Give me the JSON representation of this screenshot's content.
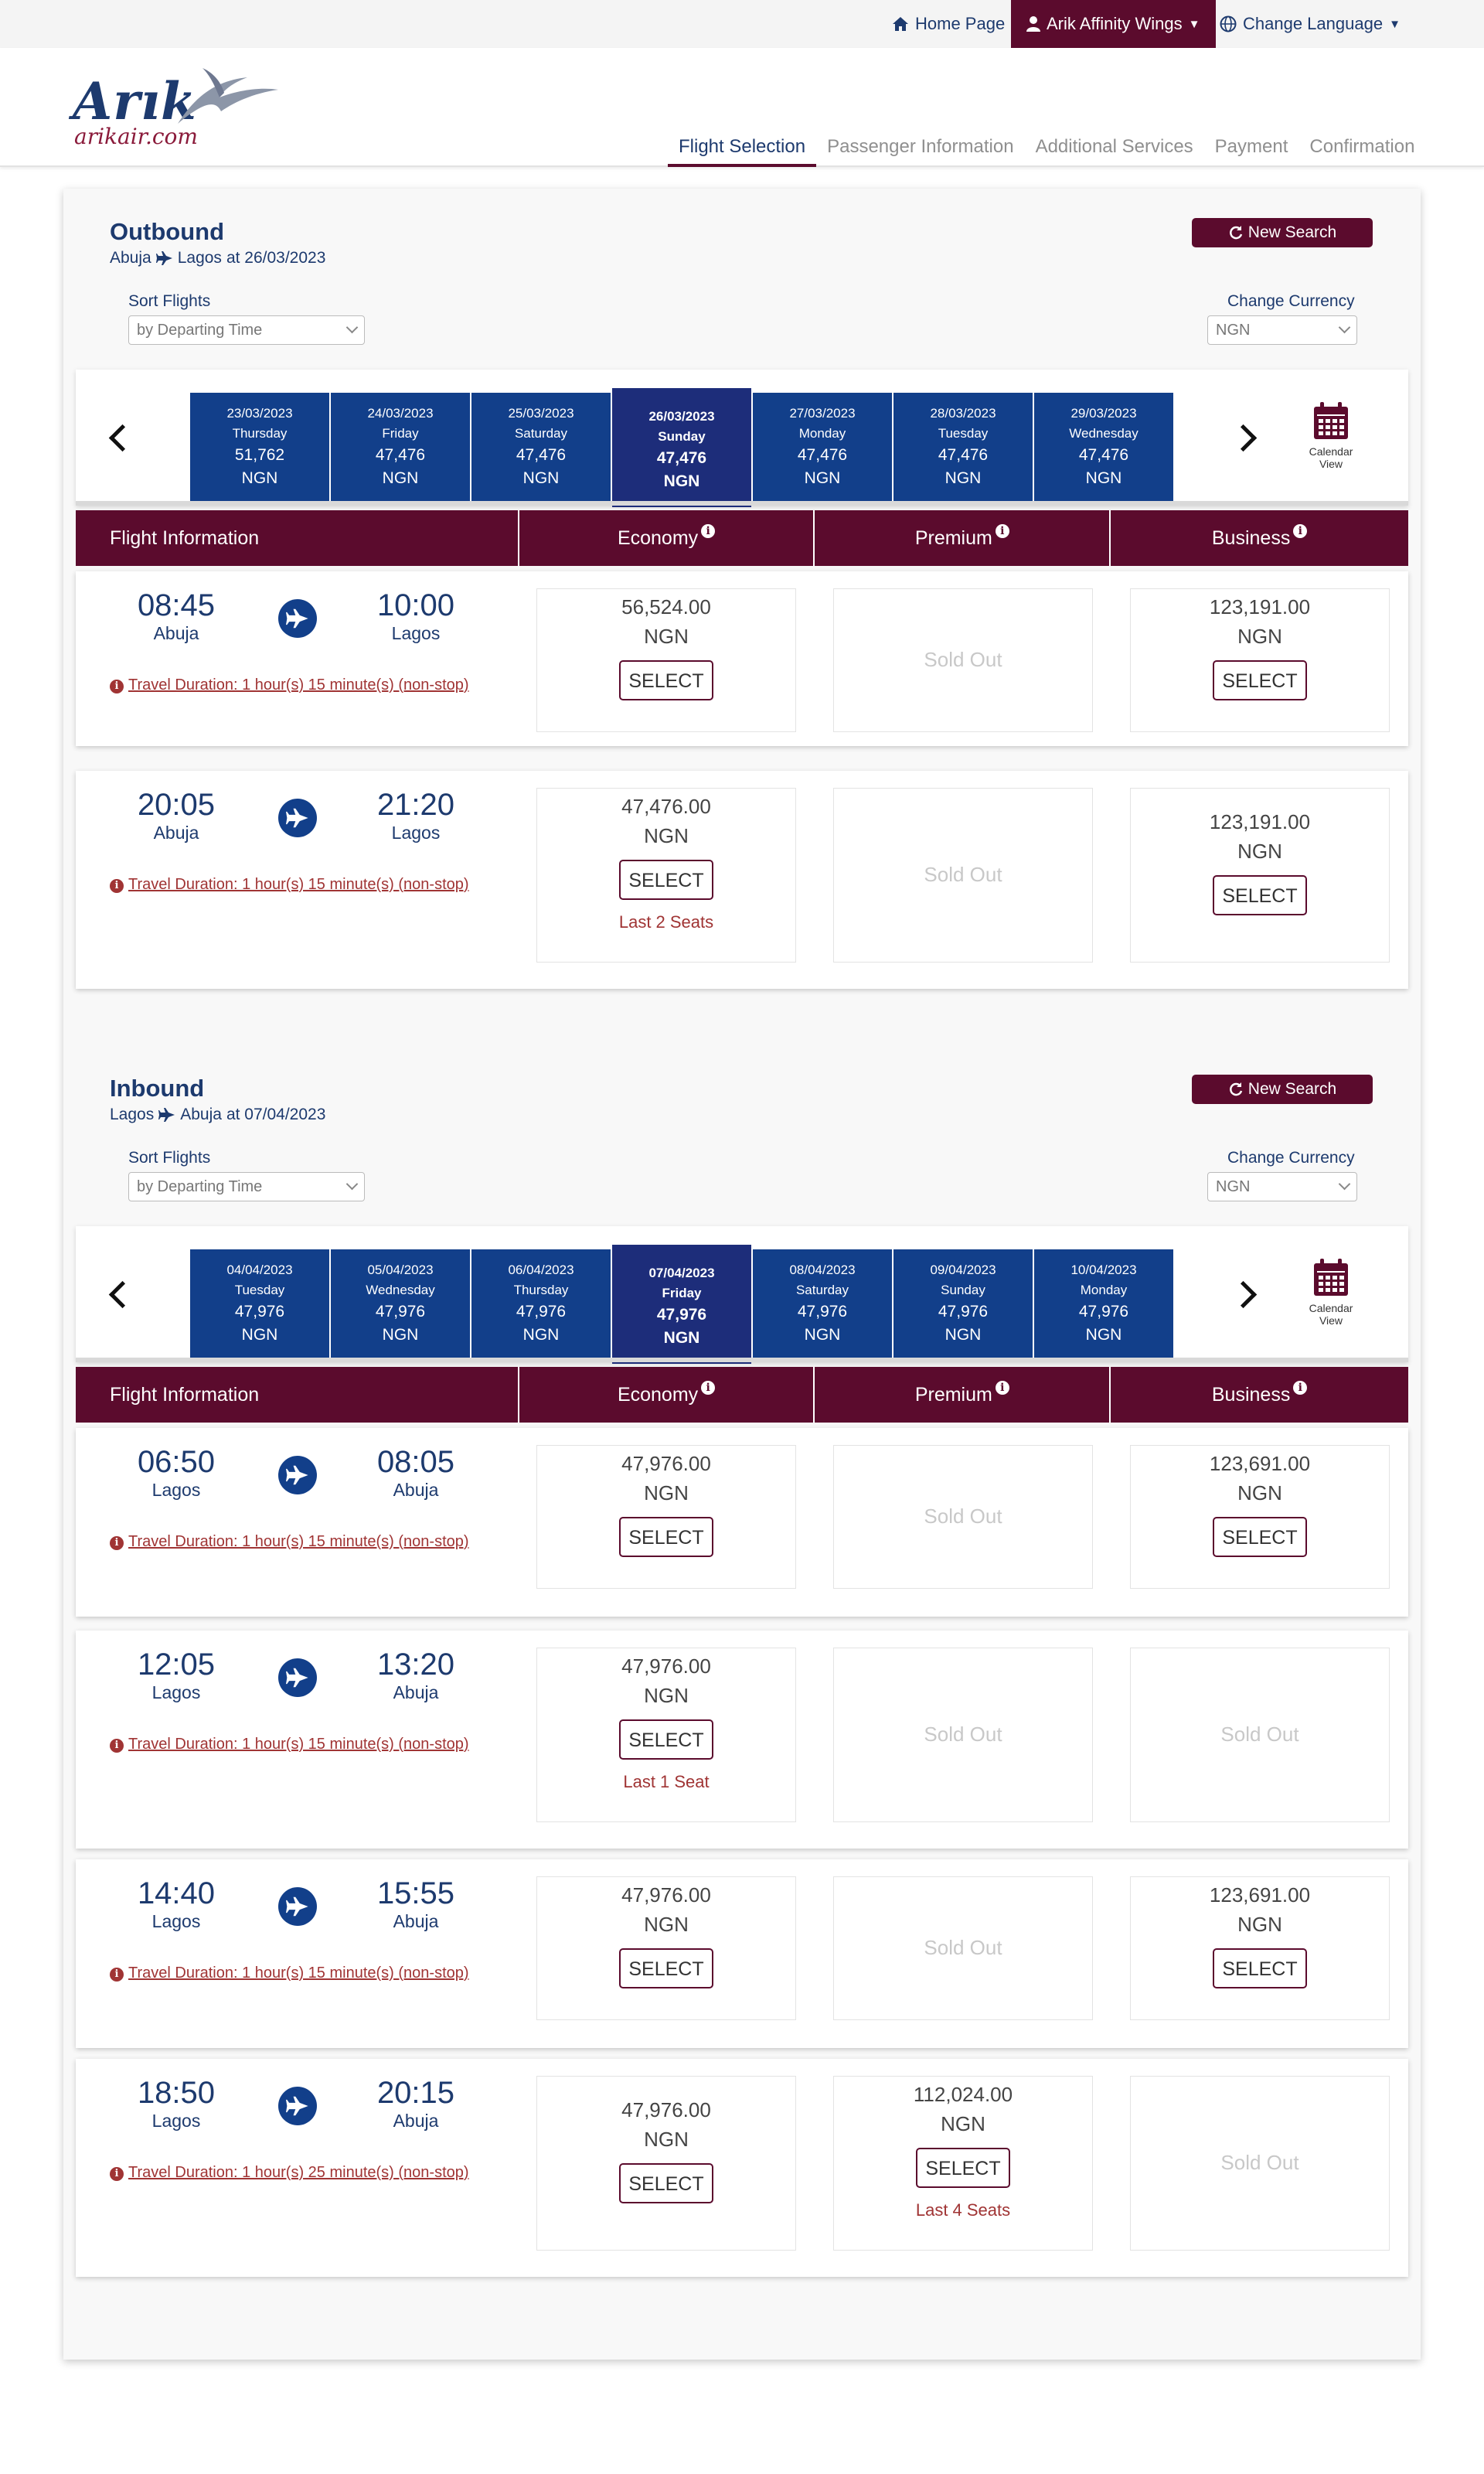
{
  "topbar": {
    "home": "Home Page",
    "affinity": "Arik Affinity Wings",
    "language": "Change Language"
  },
  "brand": {
    "name": "Arık",
    "url": "arikair.com"
  },
  "steps": [
    "Flight Selection",
    "Passenger Information",
    "Additional Services",
    "Payment",
    "Confirmation"
  ],
  "colors": {
    "primary": "#5b0b2d",
    "navy": "#1d3a6e",
    "date_tile": "#123f8a",
    "date_tile_active": "#1d2d7a",
    "alert": "#a03434"
  },
  "sections": [
    {
      "title": "Outbound",
      "from": "Abuja",
      "to": "Lagos",
      "date_text": "at 26/03/2023",
      "new_search": "New Search",
      "sort_label": "Sort Flights",
      "sort_value": "by Departing Time",
      "currency_label": "Change Currency",
      "currency_value": "NGN",
      "calendar_label": "Calendar View",
      "headers": {
        "info": "Flight Information",
        "economy": "Economy",
        "premium": "Premium",
        "business": "Business",
        "info_icon": "i"
      },
      "days": [
        {
          "date": "23/03/2023",
          "weekday": "Thursday",
          "price": "51,762",
          "cur": "NGN",
          "active": false
        },
        {
          "date": "24/03/2023",
          "weekday": "Friday",
          "price": "47,476",
          "cur": "NGN",
          "active": false
        },
        {
          "date": "25/03/2023",
          "weekday": "Saturday",
          "price": "47,476",
          "cur": "NGN",
          "active": false
        },
        {
          "date": "26/03/2023",
          "weekday": "Sunday",
          "price": "47,476",
          "cur": "NGN",
          "active": true
        },
        {
          "date": "27/03/2023",
          "weekday": "Monday",
          "price": "47,476",
          "cur": "NGN",
          "active": false
        },
        {
          "date": "28/03/2023",
          "weekday": "Tuesday",
          "price": "47,476",
          "cur": "NGN",
          "active": false
        },
        {
          "date": "29/03/2023",
          "weekday": "Wednesday",
          "price": "47,476",
          "cur": "NGN",
          "active": false
        }
      ],
      "flights": [
        {
          "dep_time": "08:45",
          "dep_city": "Abuja",
          "arr_time": "10:00",
          "arr_city": "Lagos",
          "duration": "Travel Duration: 1 hour(s) 15 minute(s) (non-stop)",
          "economy": {
            "price": "56,524.00",
            "cur": "NGN",
            "select": "SELECT",
            "seats": ""
          },
          "premium": {
            "sold_out": "Sold Out"
          },
          "business": {
            "price": "123,191.00",
            "cur": "NGN",
            "select": "SELECT",
            "seats": ""
          }
        },
        {
          "dep_time": "20:05",
          "dep_city": "Abuja",
          "arr_time": "21:20",
          "arr_city": "Lagos",
          "duration": "Travel Duration: 1 hour(s) 15 minute(s) (non-stop)",
          "economy": {
            "price": "47,476.00",
            "cur": "NGN",
            "select": "SELECT",
            "seats": "Last 2 Seats"
          },
          "premium": {
            "sold_out": "Sold Out"
          },
          "business": {
            "price": "123,191.00",
            "cur": "NGN",
            "select": "SELECT",
            "seats": ""
          }
        }
      ]
    },
    {
      "title": "Inbound",
      "from": "Lagos",
      "to": "Abuja",
      "date_text": "at 07/04/2023",
      "new_search": "New Search",
      "sort_label": "Sort Flights",
      "sort_value": "by Departing Time",
      "currency_label": "Change Currency",
      "currency_value": "NGN",
      "calendar_label": "Calendar View",
      "headers": {
        "info": "Flight Information",
        "economy": "Economy",
        "premium": "Premium",
        "business": "Business",
        "info_icon": "i"
      },
      "days": [
        {
          "date": "04/04/2023",
          "weekday": "Tuesday",
          "price": "47,976",
          "cur": "NGN",
          "active": false
        },
        {
          "date": "05/04/2023",
          "weekday": "Wednesday",
          "price": "47,976",
          "cur": "NGN",
          "active": false
        },
        {
          "date": "06/04/2023",
          "weekday": "Thursday",
          "price": "47,976",
          "cur": "NGN",
          "active": false
        },
        {
          "date": "07/04/2023",
          "weekday": "Friday",
          "price": "47,976",
          "cur": "NGN",
          "active": true
        },
        {
          "date": "08/04/2023",
          "weekday": "Saturday",
          "price": "47,976",
          "cur": "NGN",
          "active": false
        },
        {
          "date": "09/04/2023",
          "weekday": "Sunday",
          "price": "47,976",
          "cur": "NGN",
          "active": false
        },
        {
          "date": "10/04/2023",
          "weekday": "Monday",
          "price": "47,976",
          "cur": "NGN",
          "active": false
        }
      ],
      "flights": [
        {
          "dep_time": "06:50",
          "dep_city": "Lagos",
          "arr_time": "08:05",
          "arr_city": "Abuja",
          "duration": "Travel Duration: 1 hour(s) 15 minute(s) (non-stop)",
          "economy": {
            "price": "47,976.00",
            "cur": "NGN",
            "select": "SELECT",
            "seats": ""
          },
          "premium": {
            "sold_out": "Sold Out"
          },
          "business": {
            "price": "123,691.00",
            "cur": "NGN",
            "select": "SELECT",
            "seats": ""
          }
        },
        {
          "dep_time": "12:05",
          "dep_city": "Lagos",
          "arr_time": "13:20",
          "arr_city": "Abuja",
          "duration": "Travel Duration: 1 hour(s) 15 minute(s) (non-stop)",
          "economy": {
            "price": "47,976.00",
            "cur": "NGN",
            "select": "SELECT",
            "seats": "Last 1 Seat"
          },
          "premium": {
            "sold_out": "Sold Out"
          },
          "business": {
            "sold_out": "Sold Out"
          }
        },
        {
          "dep_time": "14:40",
          "dep_city": "Lagos",
          "arr_time": "15:55",
          "arr_city": "Abuja",
          "duration": "Travel Duration: 1 hour(s) 15 minute(s) (non-stop)",
          "economy": {
            "price": "47,976.00",
            "cur": "NGN",
            "select": "SELECT",
            "seats": ""
          },
          "premium": {
            "sold_out": "Sold Out"
          },
          "business": {
            "price": "123,691.00",
            "cur": "NGN",
            "select": "SELECT",
            "seats": ""
          }
        },
        {
          "dep_time": "18:50",
          "dep_city": "Lagos",
          "arr_time": "20:15",
          "arr_city": "Abuja",
          "duration": "Travel Duration: 1 hour(s) 25 minute(s) (non-stop)",
          "economy": {
            "price": "47,976.00",
            "cur": "NGN",
            "select": "SELECT",
            "seats": ""
          },
          "premium": {
            "price": "112,024.00",
            "cur": "NGN",
            "select": "SELECT",
            "seats": "Last 4 Seats"
          },
          "business": {
            "sold_out": "Sold Out"
          }
        }
      ]
    }
  ]
}
